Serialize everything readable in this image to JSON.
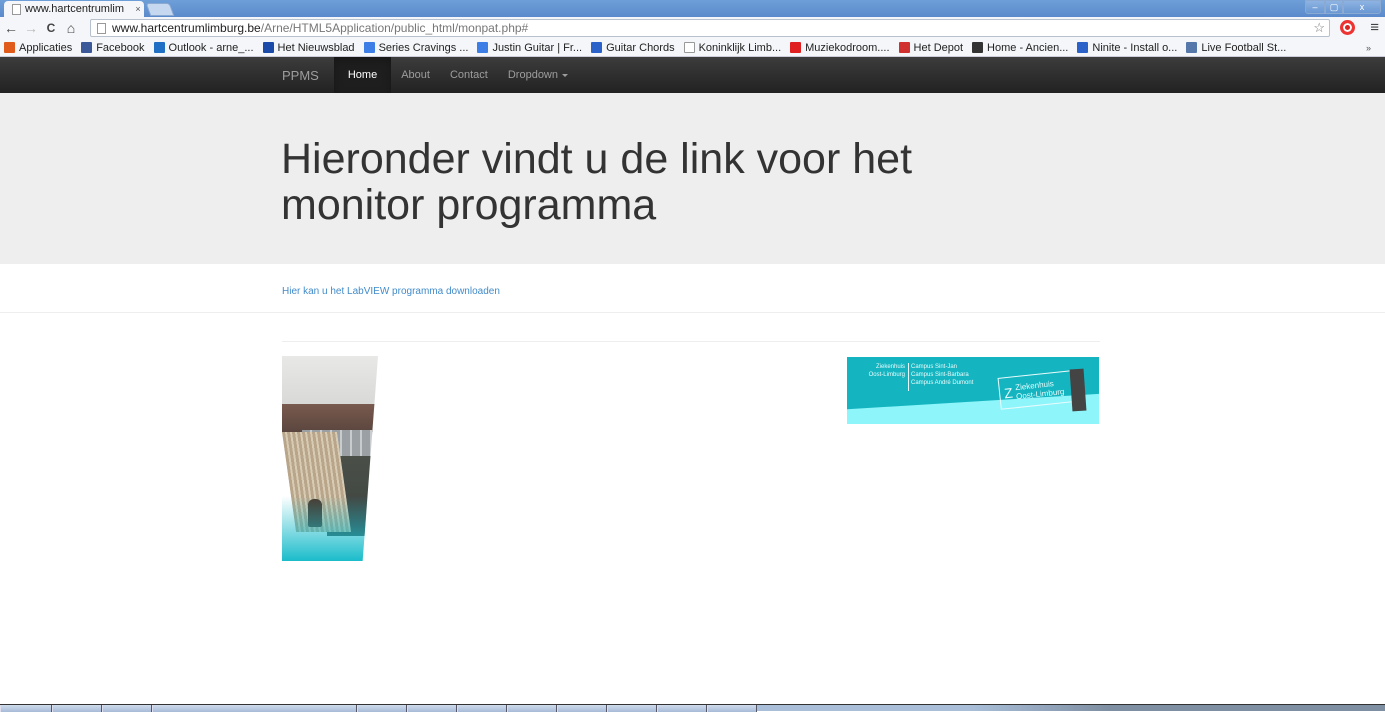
{
  "browser": {
    "tab_title": "www.hartcentrumlim",
    "tab_close": "×",
    "url_host": "www.hartcentrumlimburg.be",
    "url_path": "/Arne/HTML5Application/public_html/monpat.php#",
    "icons": {
      "back": "←",
      "forward": "→",
      "reload": "C",
      "home": "⌂",
      "star": "☆",
      "menu": "≡",
      "minimize": "–",
      "maximize": "▢",
      "close": "x"
    },
    "bookmarks": [
      {
        "label": "Applicaties",
        "icon": "apps-grid-icon",
        "color": "#e05a1c"
      },
      {
        "label": "Facebook",
        "icon": "facebook-icon",
        "color": "#3b5998"
      },
      {
        "label": "Outlook - arne_...",
        "icon": "outlook-icon",
        "color": "#1f6fc5"
      },
      {
        "label": "Het Nieuwsblad",
        "icon": "nieuwsblad-icon",
        "color": "#1c4aa8"
      },
      {
        "label": "Series Cravings ...",
        "icon": "google-search-icon",
        "color": "#3d7de6"
      },
      {
        "label": "Justin Guitar | Fr...",
        "icon": "google-search-icon",
        "color": "#3d7de6"
      },
      {
        "label": "Guitar Chords",
        "icon": "guitar-chords-icon",
        "color": "#2a62c9"
      },
      {
        "label": "Koninklijk Limb...",
        "icon": "page-icon",
        "color": "#ffffff"
      },
      {
        "label": "Muziekodroom....",
        "icon": "muziekodroom-icon",
        "color": "#e02020"
      },
      {
        "label": "Het Depot",
        "icon": "het-depot-icon",
        "color": "#d03030"
      },
      {
        "label": "Home - Ancien...",
        "icon": "ancien-icon",
        "color": "#333333"
      },
      {
        "label": "Ninite - Install o...",
        "icon": "ninite-icon",
        "color": "#2a62c9"
      },
      {
        "label": "Live Football St...",
        "icon": "football-icon",
        "color": "#5577aa"
      }
    ],
    "bookmarks_more": "»"
  },
  "navbar": {
    "brand": "PPMS",
    "items": [
      {
        "label": "Home",
        "active": true
      },
      {
        "label": "About",
        "active": false
      },
      {
        "label": "Contact",
        "active": false
      },
      {
        "label": "Dropdown",
        "active": false
      }
    ]
  },
  "jumbotron": {
    "heading": "Hieronder vindt u de link voor het monitor programma"
  },
  "content": {
    "download_link": "Hier kan u het LabVIEW programma downloaden",
    "banner": {
      "left_col": [
        "Ziekenhuis",
        "Oost-Limburg"
      ],
      "right_col": [
        "Campus Sint-Jan",
        "Campus Sint-Barbara",
        "Campus André Dumont"
      ],
      "logo_text": [
        "Ziekenhuis",
        "Oost-Limburg"
      ],
      "logo_mark": "Z"
    }
  },
  "colors": {
    "link": "#428bca",
    "navbar": "#222222",
    "jumbotron": "#eeeeee",
    "banner_teal": "#14b5c0",
    "banner_light": "#8ef5fa"
  }
}
